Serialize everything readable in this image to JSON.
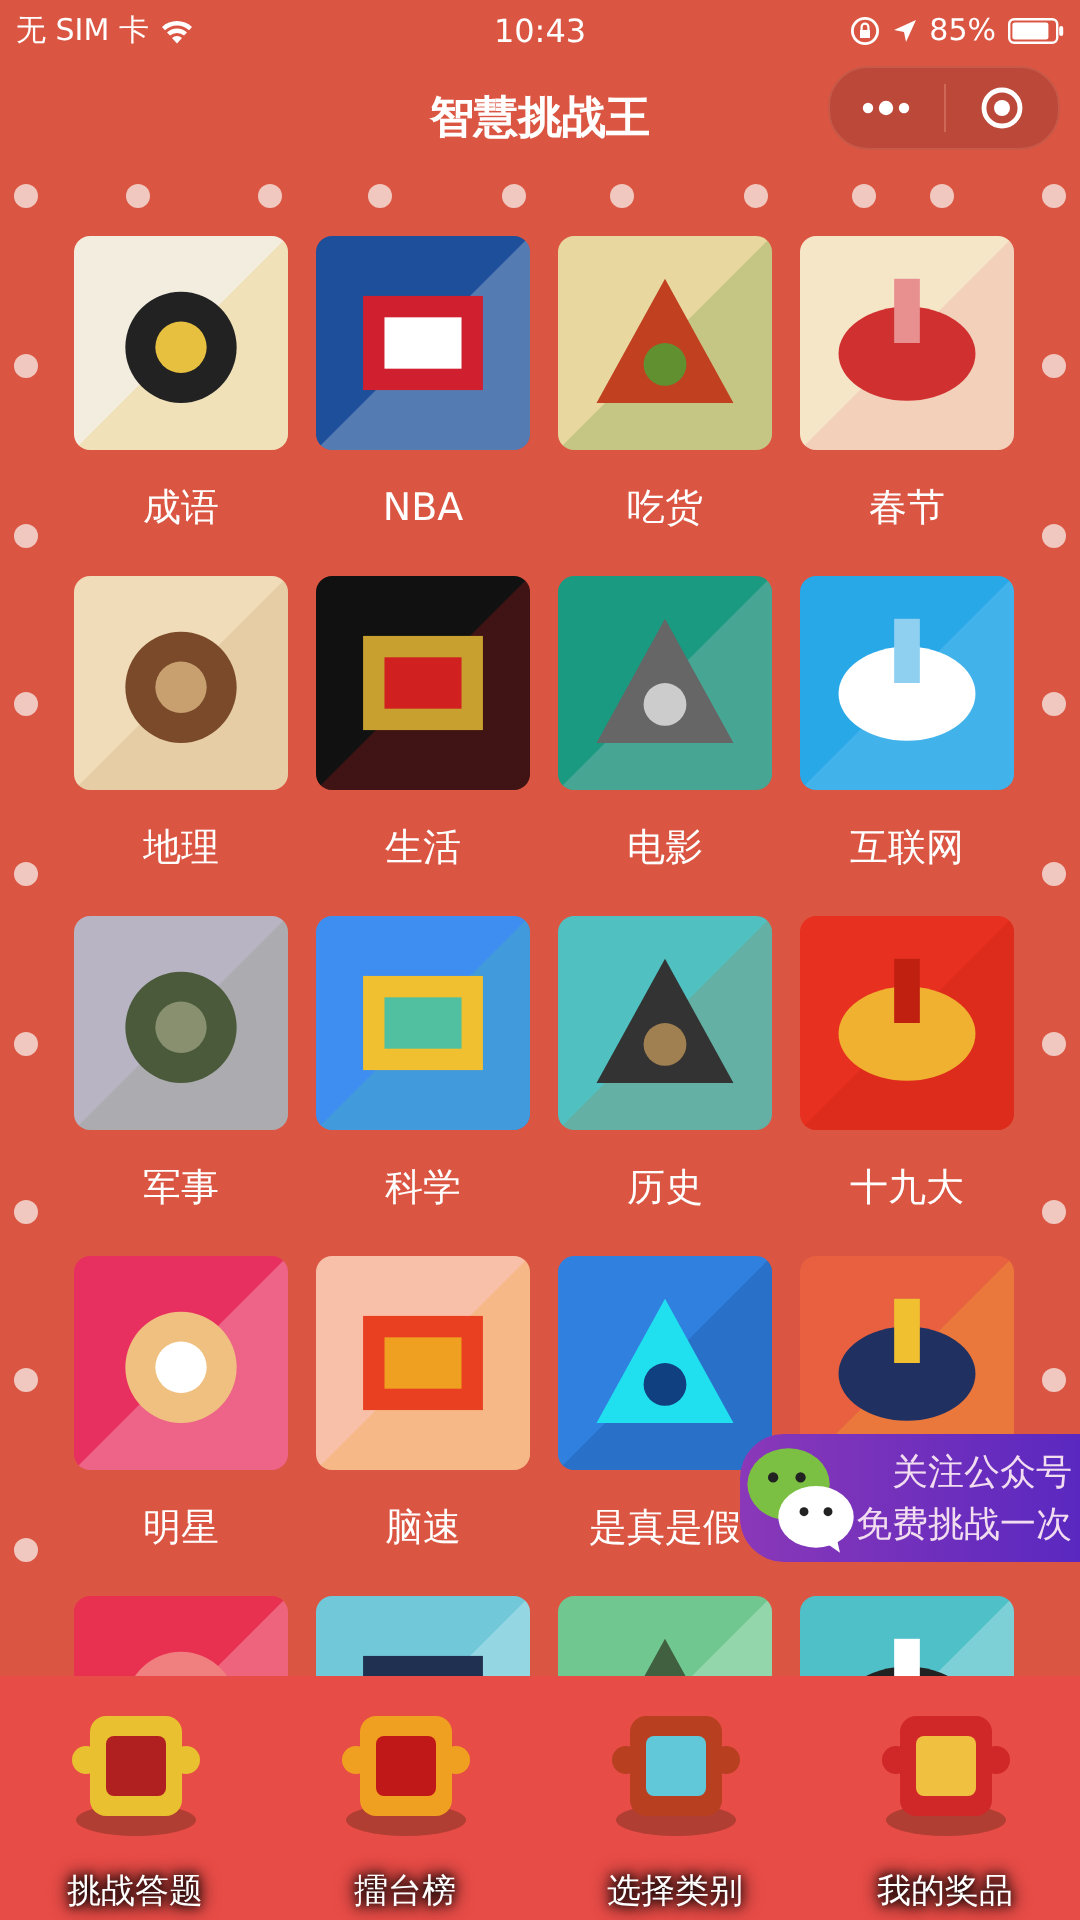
{
  "status_bar": {
    "carrier": "无 SIM 卡",
    "time": "10:43",
    "battery": "85%"
  },
  "nav_bar": {
    "title": "智慧挑战王"
  },
  "categories": [
    {
      "label": "成语",
      "kind": "picture"
    },
    {
      "label": "NBA",
      "kind": "picture"
    },
    {
      "label": "吃货",
      "kind": "picture"
    },
    {
      "label": "春节",
      "kind": "picture"
    },
    {
      "label": "地理",
      "kind": "picture"
    },
    {
      "label": "生活",
      "kind": "picture"
    },
    {
      "label": "电影",
      "kind": "picture"
    },
    {
      "label": "互联网",
      "kind": "picture"
    },
    {
      "label": "军事",
      "kind": "picture"
    },
    {
      "label": "科学",
      "kind": "picture"
    },
    {
      "label": "历史",
      "kind": "picture"
    },
    {
      "label": "十九大",
      "kind": "picture"
    },
    {
      "label": "明星",
      "kind": "picture"
    },
    {
      "label": "脑速",
      "kind": "picture"
    },
    {
      "label": "是真是假",
      "kind": "picture"
    },
    {
      "kind": "picture"
    },
    {
      "kind": "picture"
    },
    {
      "kind": "picture"
    },
    {
      "kind": "picture"
    },
    {
      "kind": "picture"
    }
  ],
  "follow_banner": {
    "lines": [
      "关注公众号",
      "免费挑战一次"
    ]
  },
  "tab_bar": [
    {
      "label": "挑战答题",
      "kind": "picture"
    },
    {
      "label": "擂台榜",
      "kind": "picture"
    },
    {
      "label": "选择类别",
      "kind": "picture"
    },
    {
      "label": "我的奖品",
      "kind": "picture"
    }
  ]
}
